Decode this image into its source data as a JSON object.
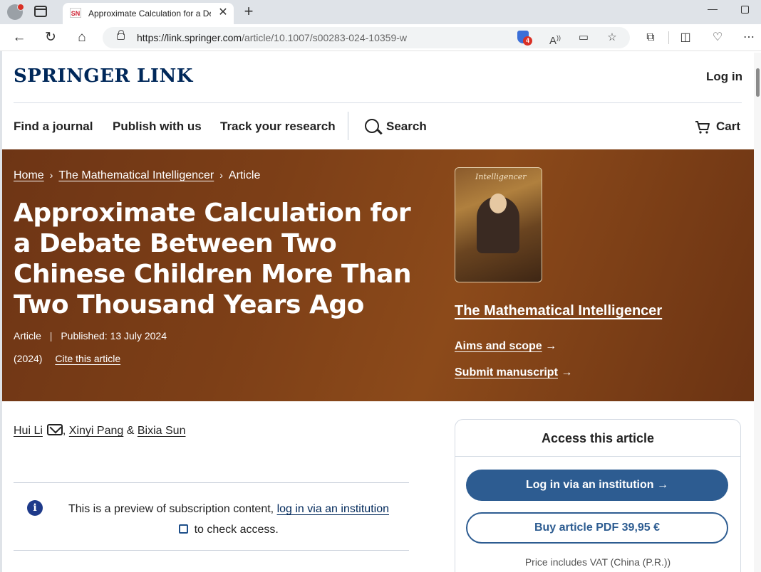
{
  "browser": {
    "tab_title": "Approximate Calculation for a De",
    "favicon_text": "SN",
    "url_domain": "https://link.springer.com",
    "url_path": "/article/10.1007/s00283-024-10359-w",
    "tracker_count": "4"
  },
  "site": {
    "logo": "SPRINGER LINK",
    "login": "Log in"
  },
  "nav": {
    "find_journal": "Find a journal",
    "publish": "Publish with us",
    "track": "Track your research",
    "search": "Search",
    "cart": "Cart"
  },
  "hero": {
    "breadcrumb": {
      "home": "Home",
      "journal": "The Mathematical Intelligencer",
      "current": "Article",
      "separator": "›"
    },
    "title": "Approximate Calculation for a Debate Between Two Chinese Children More Than Two Thousand Years Ago",
    "article_type": "Article",
    "published": "Published: 13 July 2024",
    "year": "(2024)",
    "cite": "Cite this article",
    "cover_title": "Intelligencer",
    "journal_name": "The Mathematical Intelligencer",
    "aims": "Aims and scope",
    "submit": "Submit manuscript",
    "arrow": "→"
  },
  "authors": {
    "a1": "Hui Li",
    "a2": "Xinyi Pang",
    "amp": "&",
    "a3": "Bixia Sun"
  },
  "preview": {
    "text_before": "This is a preview of subscription content, ",
    "link": "log in via an institution",
    "text_after": " to check access."
  },
  "access": {
    "title": "Access this article",
    "institution_btn": "Log in via an institution",
    "buy_btn": "Buy article PDF 39,95 €",
    "vat": "Price includes VAT (China (P.R.))"
  },
  "colors": {
    "brand": "#00285a",
    "hero_bg": "#7d3f17",
    "button": "#2d5c91"
  }
}
